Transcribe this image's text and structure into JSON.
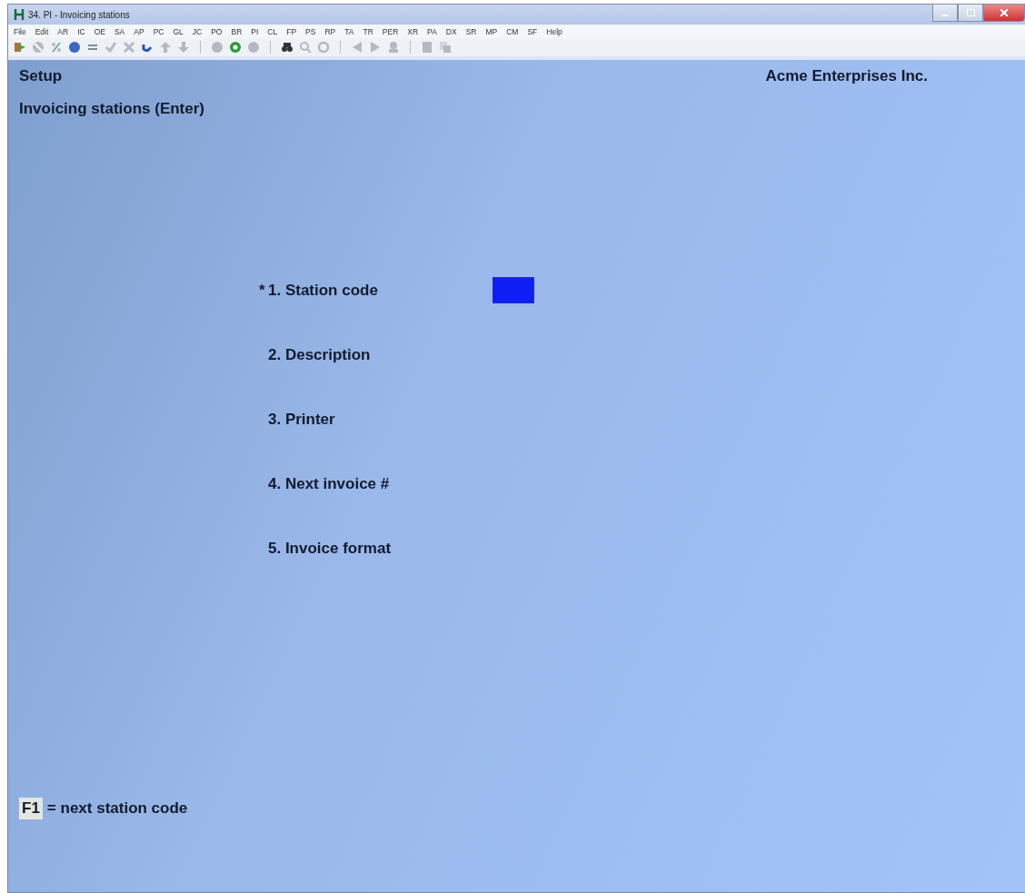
{
  "window": {
    "title": "34. PI - Invoicing stations"
  },
  "menu": [
    "File",
    "Edit",
    "AR",
    "IC",
    "OE",
    "SA",
    "AP",
    "PC",
    "GL",
    "JC",
    "PO",
    "BR",
    "PI",
    "CL",
    "FP",
    "PS",
    "RP",
    "TA",
    "TR",
    "PER",
    "XR",
    "PA",
    "DX",
    "SR",
    "MP",
    "CM",
    "SF",
    "Help"
  ],
  "header": {
    "module": "Setup",
    "company": "Acme Enterprises Inc.",
    "screen": "Invoicing stations (Enter)"
  },
  "fields": [
    {
      "marker": "*",
      "label": "1. Station code",
      "selected": true
    },
    {
      "label": "2. Description",
      "selected": false
    },
    {
      "label": "3. Printer",
      "selected": false
    },
    {
      "label": "4. Next invoice #",
      "selected": false
    },
    {
      "label": "5. Invoice format",
      "selected": false
    }
  ],
  "hint": {
    "key": "F1",
    "text": "= next station code"
  }
}
